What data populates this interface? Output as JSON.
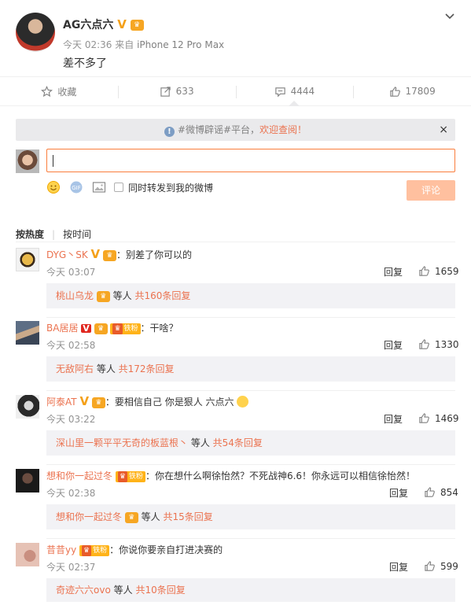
{
  "post": {
    "username": "AG六点六",
    "time": "今天 02:36",
    "source_prefix": "来自",
    "source": "iPhone 12 Pro Max",
    "content": "差不多了"
  },
  "actions": {
    "favorite_label": "收藏",
    "repost_count": "633",
    "comment_count": "4444",
    "like_count": "17809"
  },
  "notice": {
    "prefix": "#微博辟谣#平台，",
    "highlight": "欢迎查阅！",
    "close": "×"
  },
  "composer": {
    "sync_label": "同时转发到我的微博",
    "submit_label": "评论",
    "input_value": ""
  },
  "sort": {
    "hot": "按热度",
    "time": "按时间"
  },
  "comments": [
    {
      "name": "DYG丶SK",
      "text": "：别差了你可以的",
      "time": "今天 03:07",
      "reply": "回复",
      "likes": "1659",
      "sub_name": "桃山乌龙",
      "sub_mid": " 等人 ",
      "sub_more": "共160条回复"
    },
    {
      "name": "BA居居",
      "fan": "铁粉",
      "text": "：干啥？",
      "time": "今天 02:58",
      "reply": "回复",
      "likes": "1330",
      "sub_name": "无敌阿右",
      "sub_mid": " 等人 ",
      "sub_more": "共172条回复"
    },
    {
      "name": "阿泰AT",
      "text": "：要相信自己 你是狠人 六点六",
      "time": "今天 03:22",
      "reply": "回复",
      "likes": "1469",
      "sub_name": "深山里一颗平平无奇的板蓝根丶",
      "sub_mid": " 等人 ",
      "sub_more": "共54条回复"
    },
    {
      "name": "想和你一起过冬",
      "fan": "铁粉",
      "text": "：你在想什么啊徐怡然？不死战神6.6！你永远可以相信徐怡然！",
      "time": "今天 02:38",
      "reply": "回复",
      "likes": "854",
      "sub_name": "想和你一起过冬",
      "sub_mid": " 等人 ",
      "sub_more": "共15条回复"
    },
    {
      "name": "昔昔yy",
      "fan": "铁粉",
      "text": "：你说你要亲自打进决赛的",
      "time": "今天 02:37",
      "reply": "回复",
      "likes": "599",
      "sub_name": "奇迹六六ovo",
      "sub_mid": " 等人 ",
      "sub_more": "共10条回复"
    }
  ],
  "colors": {
    "accent": "#eb7350",
    "input_border": "#fa7d3c",
    "button_disabled": "#ffc09f",
    "gold_badge": "#f4a019"
  }
}
